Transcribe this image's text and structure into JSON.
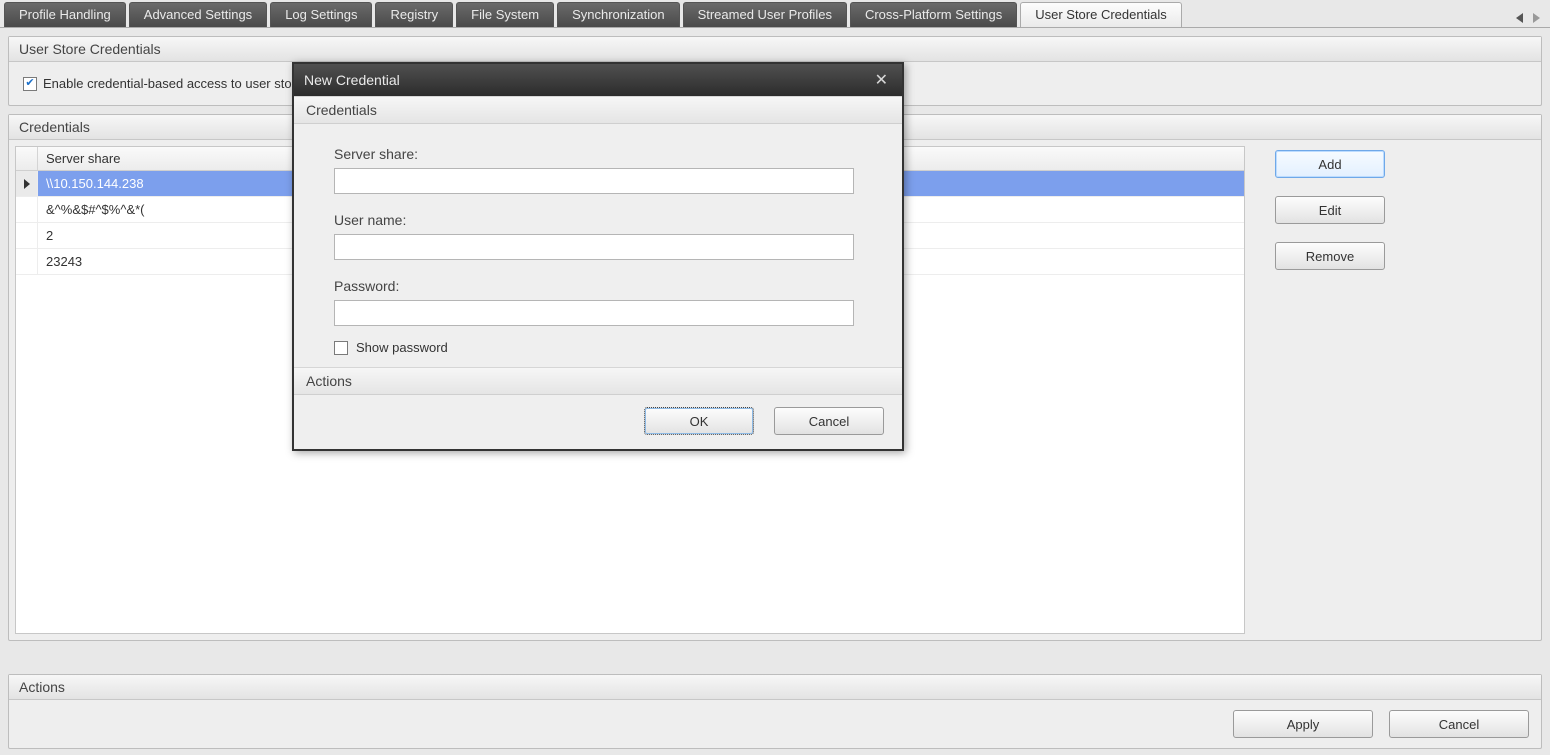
{
  "tabs": [
    {
      "label": "Profile Handling"
    },
    {
      "label": "Advanced Settings"
    },
    {
      "label": "Log Settings"
    },
    {
      "label": "Registry"
    },
    {
      "label": "File System"
    },
    {
      "label": "Synchronization"
    },
    {
      "label": "Streamed User Profiles"
    },
    {
      "label": "Cross-Platform Settings"
    },
    {
      "label": "User Store Credentials",
      "active": true
    }
  ],
  "group1": {
    "title": "User Store Credentials",
    "enable_checkbox_label": "Enable credential-based access to user stores",
    "enable_checked": true
  },
  "group2": {
    "title": "Credentials",
    "table": {
      "header": "Server share",
      "rows": [
        {
          "value": "\\\\10.150.144.238",
          "selected": true
        },
        {
          "value": "&^%&$#^$%^&*("
        },
        {
          "value": "2"
        },
        {
          "value": "23243"
        }
      ]
    },
    "buttons": {
      "add": "Add",
      "edit": "Edit",
      "remove": "Remove"
    }
  },
  "page_actions": {
    "title": "Actions",
    "apply": "Apply",
    "cancel": "Cancel"
  },
  "dialog": {
    "title": "New Credential",
    "group_label": "Credentials",
    "fields": {
      "server_share_label": "Server share:",
      "server_share_value": "",
      "username_label": "User name:",
      "username_value": "",
      "password_label": "Password:",
      "password_value": "",
      "show_password_label": "Show password",
      "show_password_checked": false
    },
    "actions": {
      "title": "Actions",
      "ok": "OK",
      "cancel": "Cancel"
    }
  }
}
